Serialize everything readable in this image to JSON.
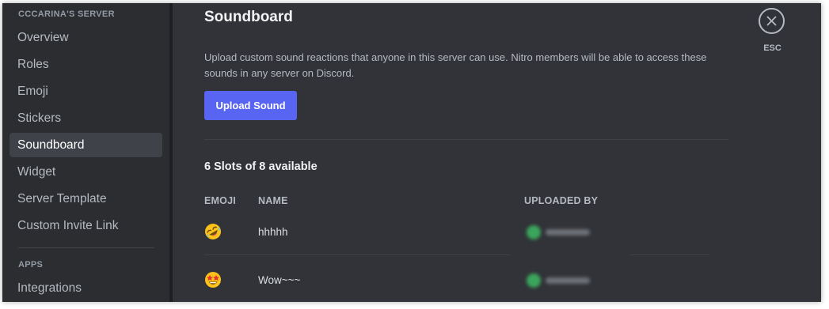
{
  "sidebar": {
    "server_header": "CCCARINA'S SERVER",
    "items": [
      {
        "label": "Overview"
      },
      {
        "label": "Roles"
      },
      {
        "label": "Emoji"
      },
      {
        "label": "Stickers"
      },
      {
        "label": "Soundboard"
      },
      {
        "label": "Widget"
      },
      {
        "label": "Server Template"
      },
      {
        "label": "Custom Invite Link"
      }
    ],
    "apps_header": "APPS",
    "apps_items": [
      {
        "label": "Integrations"
      }
    ],
    "active_item": "Soundboard"
  },
  "main": {
    "title": "Soundboard",
    "description": "Upload custom sound reactions that anyone in this server can use. Nitro members will be able to access these sounds in any server on Discord.",
    "upload_button": "Upload Sound",
    "slots_text": "6 Slots of 8 available",
    "columns": {
      "emoji": "EMOJI",
      "name": "NAME",
      "uploaded_by": "UPLOADED BY"
    },
    "sounds": [
      {
        "emoji": "rolling-on-floor-laughing-icon",
        "name": "hhhhh"
      },
      {
        "emoji": "star-struck-icon",
        "name": "Wow~~~"
      }
    ]
  },
  "close": {
    "label": "ESC"
  },
  "colors": {
    "background": "#313338",
    "sidebar": "#2b2d31",
    "active_item": "#404249",
    "accent": "#5865f2"
  }
}
